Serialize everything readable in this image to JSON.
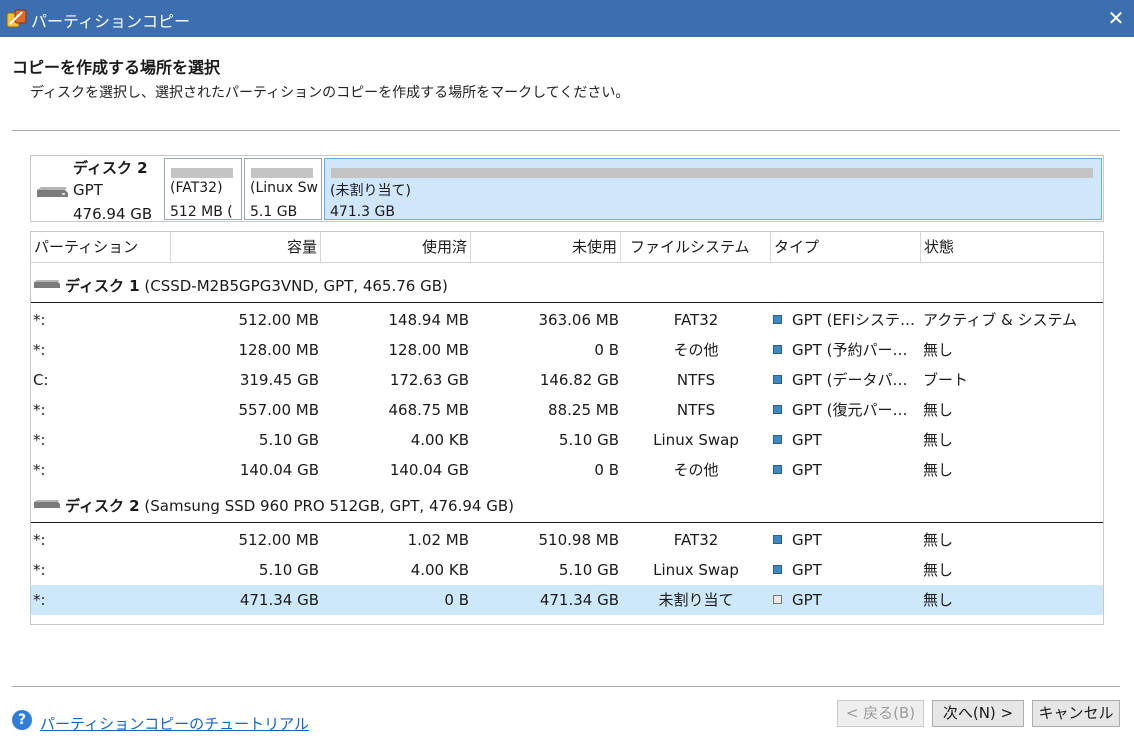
{
  "window": {
    "title": "パーティションコピー",
    "close_symbol": "✕"
  },
  "heading": "コピーを作成する場所を選択",
  "subheading": "ディスクを選択し、選択されたパーティションのコピーを作成する場所をマークしてください。",
  "disk_map": {
    "name": "ディスク 2",
    "type": "GPT",
    "size": "476.94 GB",
    "blocks": [
      {
        "fs": "(FAT32)",
        "size": "512 MB ("
      },
      {
        "fs": "(Linux Sw",
        "size": "5.1 GB"
      },
      {
        "fs": "(未割り当て)",
        "size": "471.3 GB",
        "selected": true
      }
    ]
  },
  "columns": [
    "パーティション",
    "容量",
    "使用済",
    "未使用",
    "ファイルシステム",
    "タイプ",
    "状態"
  ],
  "disks": [
    {
      "name": "ディスク 1",
      "detail": " (CSSD-M2B5GPG3VND, GPT, 465.76 GB)",
      "rows": [
        {
          "partition": "*:",
          "capacity": "512.00 MB",
          "used": "148.94 MB",
          "unused": "363.06 MB",
          "fs": "FAT32",
          "type": "GPT (EFIシステ…",
          "status": "アクティブ & システム"
        },
        {
          "partition": "*:",
          "capacity": "128.00 MB",
          "used": "128.00 MB",
          "unused": "0 B",
          "fs": "その他",
          "type": "GPT (予約パー…",
          "status": "無し"
        },
        {
          "partition": "C:",
          "capacity": "319.45 GB",
          "used": "172.63 GB",
          "unused": "146.82 GB",
          "fs": "NTFS",
          "type": "GPT (データパ…",
          "status": "ブート"
        },
        {
          "partition": "*:",
          "capacity": "557.00 MB",
          "used": "468.75 MB",
          "unused": "88.25 MB",
          "fs": "NTFS",
          "type": "GPT (復元パー…",
          "status": "無し"
        },
        {
          "partition": "*:",
          "capacity": "5.10 GB",
          "used": "4.00 KB",
          "unused": "5.10 GB",
          "fs": "Linux Swap",
          "type": "GPT",
          "status": "無し"
        },
        {
          "partition": "*:",
          "capacity": "140.04 GB",
          "used": "140.04 GB",
          "unused": "0 B",
          "fs": "その他",
          "type": "GPT",
          "status": "無し"
        }
      ]
    },
    {
      "name": "ディスク 2",
      "detail": " (Samsung SSD 960 PRO 512GB, GPT, 476.94 GB)",
      "rows": [
        {
          "partition": "*:",
          "capacity": "512.00 MB",
          "used": "1.02 MB",
          "unused": "510.98 MB",
          "fs": "FAT32",
          "type": "GPT",
          "status": "無し"
        },
        {
          "partition": "*:",
          "capacity": "5.10 GB",
          "used": "4.00 KB",
          "unused": "5.10 GB",
          "fs": "Linux Swap",
          "type": "GPT",
          "status": "無し"
        },
        {
          "partition": "*:",
          "capacity": "471.34 GB",
          "used": "0 B",
          "unused": "471.34 GB",
          "fs": "未割り当て",
          "type": "GPT",
          "status": "無し",
          "selected": true,
          "unallocated": true
        }
      ]
    }
  ],
  "footer": {
    "help_symbol": "?",
    "help_link": "パーティションコピーのチュートリアル",
    "back": "< 戻る(B)",
    "next": "次へ(N) >",
    "cancel": "キャンセル"
  }
}
